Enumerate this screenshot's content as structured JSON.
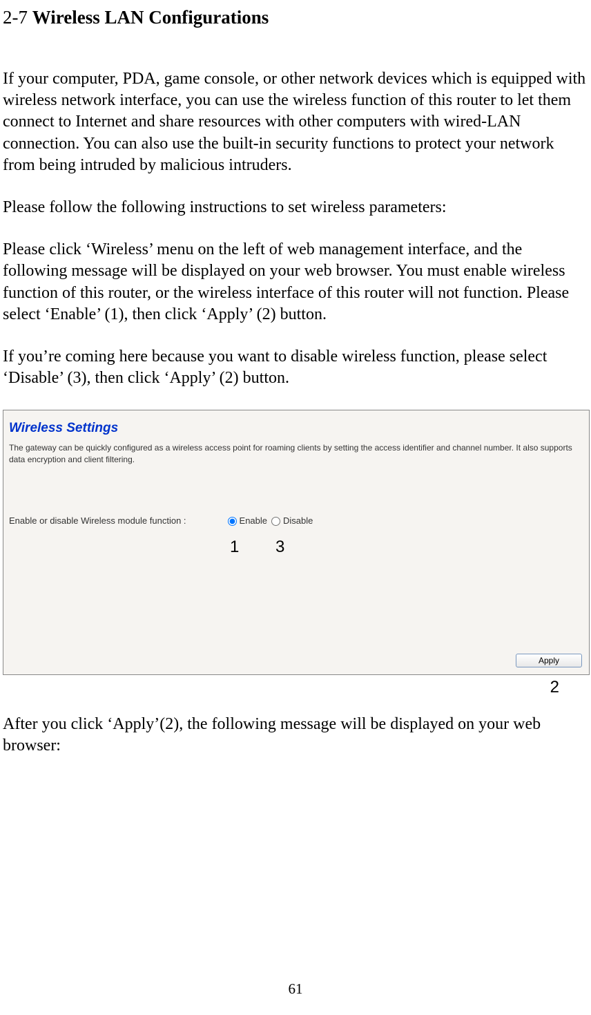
{
  "heading": {
    "section_num": "2-7",
    "section_title": "Wireless LAN Configurations"
  },
  "paragraphs": {
    "p1": "If your computer, PDA, game console, or other network devices which is equipped with wireless network interface, you can use the wireless function of this router to let them connect to Internet and share resources with other computers with wired-LAN connection. You can also use the built-in security functions to protect your network from being intruded by malicious intruders.",
    "p2": "Please follow the following instructions to set wireless parameters:",
    "p3": "Please click ‘Wireless’ menu on the left of web management interface, and the following message will be displayed on your web browser. You must enable wireless function of this router, or the wireless interface of this router will not function. Please select ‘Enable’ (1), then click ‘Apply’ (2) button.",
    "p4": "If you’re coming here because you want to disable wireless function, please select ‘Disable’ (3), then click ‘Apply’ (2) button.",
    "p5": "After you click ‘Apply’(2), the following message will be displayed on your web browser:"
  },
  "screenshot": {
    "title": "Wireless Settings",
    "description": "The gateway can be quickly configured as a wireless access point for roaming clients by setting the access identifier and channel number. It also supports data encryption and client filtering.",
    "enable_label": "Enable or disable Wireless module function :",
    "radio_enable": "Enable",
    "radio_disable": "Disable",
    "apply_label": "Apply"
  },
  "annotations": {
    "a1": "1",
    "a2": "2",
    "a3": "3"
  },
  "page_number": "61"
}
